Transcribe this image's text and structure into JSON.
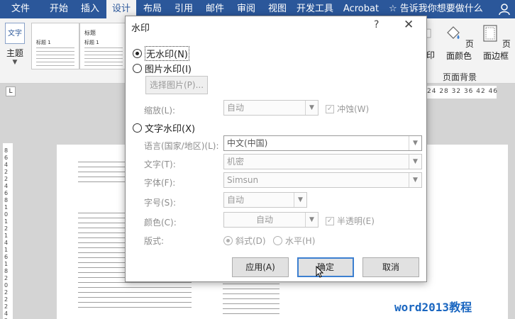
{
  "ribbon_tabs": [
    {
      "label": "文件"
    },
    {
      "label": "开始"
    },
    {
      "label": "插入"
    },
    {
      "label": "设计"
    },
    {
      "label": "布局"
    },
    {
      "label": "引用"
    },
    {
      "label": "邮件"
    },
    {
      "label": "审阅"
    },
    {
      "label": "视图"
    },
    {
      "label": "开发工具"
    },
    {
      "label": "Acrobat"
    }
  ],
  "tell_me": "告诉我你想要做什么",
  "ribbon": {
    "theme_label": "主题",
    "theme_icon_text": "文字",
    "style_thumbs": [
      {
        "heading": "",
        "subtitle": "标题 1"
      },
      {
        "heading": "标题",
        "subtitle": "标题 1"
      }
    ],
    "watermark_partial": "印",
    "page_color": "页面颜色",
    "page_border": "页面边框",
    "group_label": "页面背景"
  },
  "ruler_numbers": "24 28 32 36  42 46",
  "vertical_ruler_text": "8 6 4 2 2 4 6 8 10 12 14 16 18 20 22 24 26",
  "watermark_label": "word2013教程",
  "dialog": {
    "title": "水印",
    "help": "?",
    "close": "✕",
    "no_watermark": "无水印(N)",
    "picture_watermark": "图片水印(I)",
    "select_picture": "选择图片(P)...",
    "scale_label": "缩放(L):",
    "scale_value": "自动",
    "washout": "冲蚀(W)",
    "text_watermark": "文字水印(X)",
    "language_label": "语言(国家/地区)(L):",
    "language_value": "中文(中国)",
    "text_label": "文字(T):",
    "text_value": "机密",
    "font_label": "字体(F):",
    "font_value": "Simsun",
    "size_label": "字号(S):",
    "size_value": "自动",
    "color_label": "颜色(C):",
    "color_value": "自动",
    "semitransparent": "半透明(E)",
    "layout_label": "版式:",
    "diagonal": "斜式(D)",
    "horizontal": "水平(H)",
    "apply": "应用(A)",
    "ok": "确定",
    "cancel": "取消"
  },
  "colors": {
    "accent": "#2b579a",
    "watermark_label": "#1a66c0",
    "default_button_border": "#3c7fd0"
  }
}
